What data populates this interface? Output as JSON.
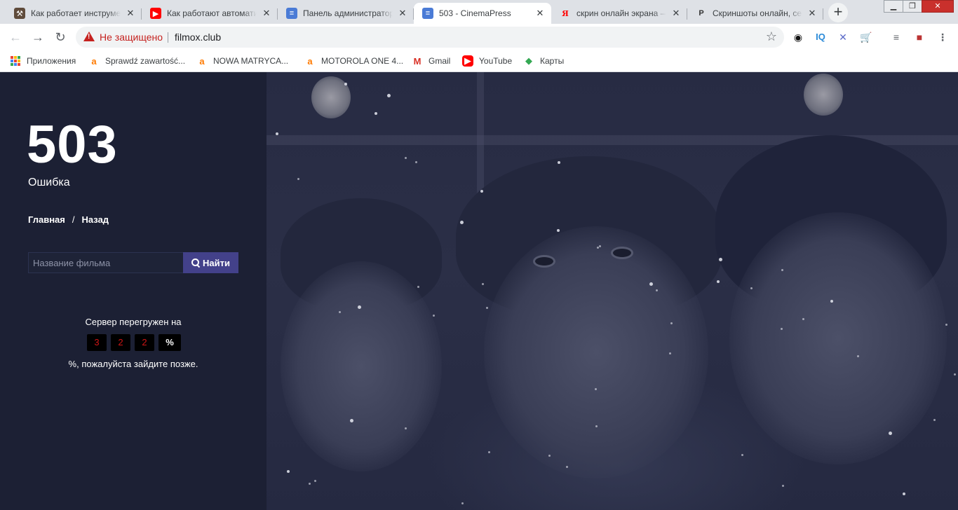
{
  "browser": {
    "tabs": [
      {
        "title": "Как работает инструмент",
        "icon": "tool-icon"
      },
      {
        "title": "Как работают автоматические",
        "icon": "youtube-icon"
      },
      {
        "title": "Панель администратора",
        "icon": "database-icon"
      },
      {
        "title": "503 - CinemaPress",
        "icon": "database-icon",
        "active": true
      },
      {
        "title": "скрин онлайн экрана — ",
        "icon": "yandex-icon"
      },
      {
        "title": "Скриншоты онлайн, сер",
        "icon": "p-icon"
      }
    ],
    "address": {
      "security_label": "Не защищено",
      "url": "filmox.club"
    },
    "bookmarks": [
      {
        "label": "Приложения",
        "icon": "apps-grid-icon"
      },
      {
        "label": "Sprawdź zawartość...",
        "icon": "amazon-icon"
      },
      {
        "label": "NOWA MATRYCA...",
        "icon": "amazon-icon"
      },
      {
        "label": "MOTOROLA ONE 4...",
        "icon": "amazon-icon"
      },
      {
        "label": "Gmail",
        "icon": "gmail-icon"
      },
      {
        "label": "YouTube",
        "icon": "youtube-icon"
      },
      {
        "label": "Карты",
        "icon": "maps-icon"
      }
    ]
  },
  "error_page": {
    "code": "503",
    "subtitle": "Ошибка",
    "breadcrumb": {
      "home": "Главная",
      "separator": "/",
      "back": "Назад"
    },
    "search": {
      "placeholder": "Название фильма",
      "button": "Найти"
    },
    "load_prefix": "Сервер перегружен на",
    "load_digits": [
      "3",
      "2",
      "2"
    ],
    "load_unit": "%",
    "load_suffix": "%, пожалуйста зайдите позже."
  },
  "colors": {
    "page_bg": "#1c2034",
    "button_bg": "#43418a",
    "digit_red": "#d01515",
    "insecure_red": "#c5221f"
  }
}
